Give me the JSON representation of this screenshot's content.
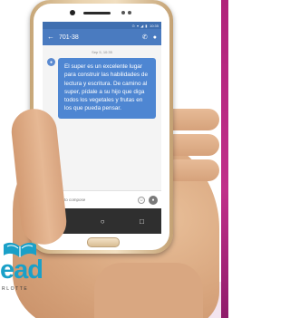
{
  "status_bar": {
    "icons": "⊙ ▾ ◢ ▮",
    "time": "10:35"
  },
  "header": {
    "title": "701-38",
    "back_icon": "←",
    "call_icon": "✆",
    "contact_icon": "●"
  },
  "conversation": {
    "date": "Sep 5, 10:35",
    "avatar_icon": "●",
    "message": "El super es un excelente lugar para construir las habilidades de lectura y escritura. De camino al super, pídale a su hijo que diga todos los vegetales y frutas en los que pueda pensar."
  },
  "composer": {
    "attach_icon": "⊝",
    "placeholder": "Type to compose",
    "emoji_icon": "☺",
    "send_icon": "●"
  },
  "nav_bar": {
    "back": "◁",
    "home": "○",
    "recent": "□"
  },
  "logo": {
    "word": "ead",
    "sub": "RLOTTE"
  },
  "colors": {
    "app_bar": "#4a7bc0",
    "bubble": "#4e86d2",
    "logo": "#1aa0c8",
    "accent_edge": "#b0237a"
  }
}
